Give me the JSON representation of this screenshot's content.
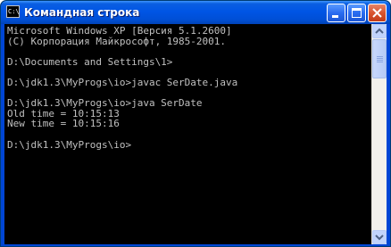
{
  "window": {
    "title": "Командная строка",
    "icon": "cmd-icon",
    "icon_text": "C:\\",
    "controls": [
      "minimize-icon",
      "maximize-icon",
      "close-icon"
    ]
  },
  "console": {
    "lines": [
      "Microsoft Windows XP [Версия 5.1.2600]",
      "(С) Корпорация Майкрософт, 1985-2001.",
      "",
      "D:\\Documents and Settings\\1>",
      "",
      "D:\\jdk1.3\\MyProgs\\io>javac SerDate.java",
      "",
      "D:\\jdk1.3\\MyProgs\\io>java SerDate",
      "Old time = 10:15:13",
      "New time = 10:15:16",
      "",
      "D:\\jdk1.3\\MyProgs\\io>"
    ]
  },
  "colors": {
    "titlebar": "#0055e5",
    "console_bg": "#000000",
    "console_fg": "#c0c0c0",
    "close_button": "#d9552f"
  }
}
